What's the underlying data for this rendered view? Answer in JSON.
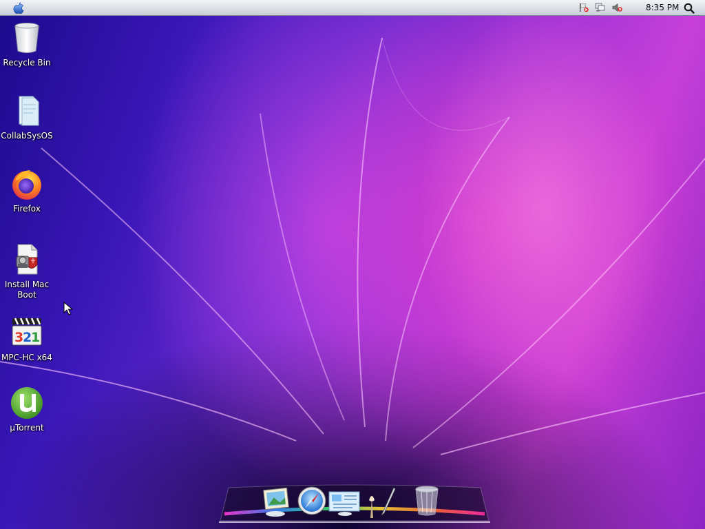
{
  "menubar": {
    "clock": "8:35 PM",
    "tray_icons": [
      "flag-alert-icon",
      "network-disconnected-icon",
      "volume-muted-icon"
    ]
  },
  "desktop_icons": [
    {
      "label": "Recycle Bin",
      "icon": "recycle-bin-icon"
    },
    {
      "label": "CollabSysOS",
      "icon": "folder-icon"
    },
    {
      "label": "Firefox",
      "icon": "firefox-icon"
    },
    {
      "label": "Install Mac Boot",
      "icon": "installer-icon"
    },
    {
      "label": "MPC-HC x64",
      "icon": "mpc-hc-icon"
    },
    {
      "label": "µTorrent",
      "icon": "utorrent-icon"
    }
  ],
  "dock": {
    "items": [
      "preview-icon",
      "safari-icon",
      "mail-icon",
      "photo-booth-icon",
      "pen-icon",
      "trash-icon"
    ]
  },
  "colors": {
    "wallpaper_primary": "#6a2ad0",
    "wallpaper_accent": "#e43fc8",
    "menubar_bg": "#dfe3ea"
  }
}
